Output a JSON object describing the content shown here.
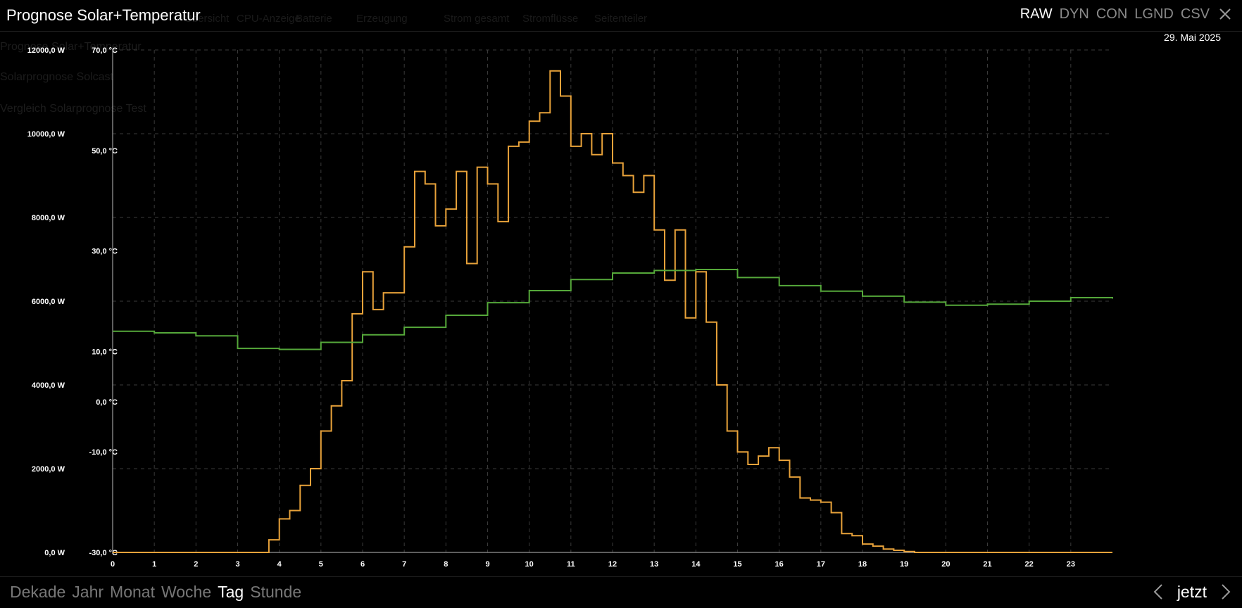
{
  "background_nav": [
    "Übersicht",
    "CPU-Anzeige",
    "Batterie",
    "Erzeugung",
    "Strom gesamt",
    "Stromflüsse",
    "Seitenteiler"
  ],
  "background_subtitles": [
    "Prognose Solar+Temperatur",
    "Solarprognose Solcast",
    "Vergleich Solarprognose Test"
  ],
  "header": {
    "title": "Prognose Solar+Temperatur",
    "modes": [
      "RAW",
      "DYN",
      "CON",
      "LGND",
      "CSV"
    ],
    "active_mode": "RAW",
    "close_icon": "close-icon",
    "date": "29. Mai 2025"
  },
  "footer": {
    "periods": [
      "Dekade",
      "Jahr",
      "Monat",
      "Woche",
      "Tag",
      "Stunde"
    ],
    "active_period": "Tag",
    "prev_icon": "chevron-left-icon",
    "now_label": "jetzt",
    "next_icon": "chevron-right-icon"
  },
  "chart_data": {
    "type": "line",
    "step": true,
    "grid": true,
    "title": "",
    "xlabel": "",
    "x_ticks": [
      "0",
      "1",
      "2",
      "3",
      "4",
      "5",
      "6",
      "7",
      "8",
      "9",
      "10",
      "11",
      "12",
      "13",
      "14",
      "15",
      "16",
      "17",
      "18",
      "19",
      "20",
      "21",
      "22",
      "23"
    ],
    "xlim": [
      0,
      24
    ],
    "y_left": {
      "ylim": [
        0,
        12000
      ],
      "ticks": [
        "0,0 W",
        "2000,0 W",
        "4000,0 W",
        "6000,0 W",
        "8000,0 W",
        "10000,0 W",
        "12000,0 W"
      ]
    },
    "y_right": {
      "ylim": [
        -30,
        70
      ],
      "ticks": [
        "-30,0 °C",
        "-10,0 °C",
        "0,0 °C",
        "10,0 °C",
        "30,0 °C",
        "50,0 °C",
        "70,0 °C"
      ],
      "tick_values": [
        -30,
        -10,
        0,
        10,
        30,
        50,
        70
      ]
    },
    "series": [
      {
        "color": "#e8a23a",
        "axis": "left",
        "unit": "W",
        "points": [
          [
            0,
            0
          ],
          [
            3.5,
            0
          ],
          [
            3.75,
            300
          ],
          [
            4,
            800
          ],
          [
            4.25,
            1000
          ],
          [
            4.5,
            1600
          ],
          [
            4.75,
            2000
          ],
          [
            5,
            2900
          ],
          [
            5.25,
            3500
          ],
          [
            5.5,
            4100
          ],
          [
            5.75,
            5700
          ],
          [
            6,
            6700
          ],
          [
            6,
            6700
          ],
          [
            6.25,
            5800
          ],
          [
            6.5,
            6200
          ],
          [
            6.75,
            6200
          ],
          [
            7,
            7300
          ],
          [
            7.25,
            9100
          ],
          [
            7.5,
            8800
          ],
          [
            7.75,
            7800
          ],
          [
            8,
            8200
          ],
          [
            8.25,
            9100
          ],
          [
            8.5,
            6900
          ],
          [
            8.75,
            9200
          ],
          [
            9,
            8800
          ],
          [
            9.25,
            7900
          ],
          [
            9.5,
            9700
          ],
          [
            9.75,
            9800
          ],
          [
            10,
            10300
          ],
          [
            10.25,
            10500
          ],
          [
            10.5,
            11500
          ],
          [
            10.75,
            10900
          ],
          [
            11,
            9700
          ],
          [
            11.25,
            10000
          ],
          [
            11.5,
            9500
          ],
          [
            11.75,
            10000
          ],
          [
            12,
            9300
          ],
          [
            12.25,
            9000
          ],
          [
            12.5,
            8600
          ],
          [
            12.75,
            9000
          ],
          [
            13,
            7700
          ],
          [
            13,
            7700
          ],
          [
            13.25,
            6500
          ],
          [
            13.5,
            7700
          ],
          [
            13.75,
            5600
          ],
          [
            14,
            6700
          ],
          [
            14.25,
            5500
          ],
          [
            14.5,
            4000
          ],
          [
            14.75,
            2900
          ],
          [
            15,
            2400
          ],
          [
            15.25,
            2100
          ],
          [
            15.5,
            2300
          ],
          [
            15.75,
            2500
          ],
          [
            16,
            2200
          ],
          [
            16.25,
            1800
          ],
          [
            16.5,
            1300
          ],
          [
            16.75,
            1250
          ],
          [
            17,
            1200
          ],
          [
            17.25,
            950
          ],
          [
            17.5,
            450
          ],
          [
            17.75,
            400
          ],
          [
            18,
            200
          ],
          [
            18.25,
            150
          ],
          [
            18.5,
            80
          ],
          [
            18.75,
            50
          ],
          [
            19,
            20
          ],
          [
            19.25,
            0
          ],
          [
            24,
            0
          ]
        ]
      },
      {
        "color": "#55a83a",
        "axis": "right",
        "unit": "°C",
        "points": [
          [
            0,
            14
          ],
          [
            1,
            13.7
          ],
          [
            2,
            13.1
          ],
          [
            3,
            10.6
          ],
          [
            4,
            10.4
          ],
          [
            5,
            11.8
          ],
          [
            6,
            13.3
          ],
          [
            7,
            14.8
          ],
          [
            8,
            17.2
          ],
          [
            9,
            19.7
          ],
          [
            10,
            22.1
          ],
          [
            11,
            24.3
          ],
          [
            12,
            25.6
          ],
          [
            13,
            26.1
          ],
          [
            14,
            26.3
          ],
          [
            15,
            24.7
          ],
          [
            16,
            23.1
          ],
          [
            17,
            22
          ],
          [
            18,
            21
          ],
          [
            19,
            19.8
          ],
          [
            20,
            19.2
          ],
          [
            21,
            19.4
          ],
          [
            22,
            20
          ],
          [
            23,
            20.7
          ],
          [
            24,
            20.5
          ]
        ]
      }
    ]
  }
}
